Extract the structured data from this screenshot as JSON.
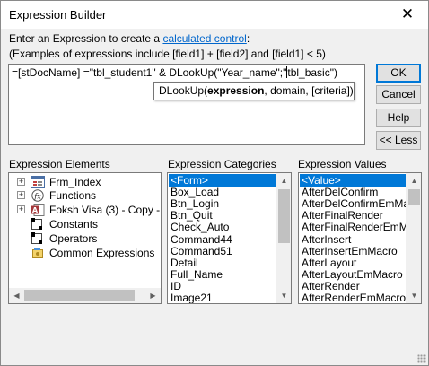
{
  "window": {
    "title": "Expression Builder",
    "close_glyph": "✕"
  },
  "instructions": {
    "line1_prefix": "Enter an Expression to create a ",
    "line1_link": "calculated control",
    "line1_suffix": ":",
    "line2": "(Examples of expressions include [field1] + [field2] and [field1] < 5)"
  },
  "expression": {
    "text_before_caret": "=[stDocName] =\"tbl_student1\" & DLookUp(\"Year_name\";\"",
    "text_after_caret": "tbl_basic\")",
    "tooltip": {
      "func": "DLookUp(",
      "bold_arg": "expression",
      "rest": ", domain, [criteria])"
    }
  },
  "buttons": {
    "ok": "OK",
    "cancel": "Cancel",
    "help": "Help",
    "less": "<< Less"
  },
  "columns": {
    "elements_label": "Expression Elements",
    "categories_label": "Expression Categories",
    "values_label": "Expression Values"
  },
  "elements": [
    {
      "label": "Frm_Index",
      "icon": "form-icon",
      "expandable": true
    },
    {
      "label": "Functions",
      "icon": "function-icon",
      "expandable": true
    },
    {
      "label": "Foksh Visa (3) - Copy - Cop",
      "icon": "database-icon",
      "expandable": true
    },
    {
      "label": "Constants",
      "icon": "constants-icon",
      "expandable": false
    },
    {
      "label": "Operators",
      "icon": "operators-icon",
      "expandable": false
    },
    {
      "label": "Common Expressions",
      "icon": "common-expressions-icon",
      "expandable": false
    }
  ],
  "categories": [
    "<Form>",
    "Box_Load",
    "Btn_Login",
    "Btn_Quit",
    "Check_Auto",
    "Command44",
    "Command51",
    "Detail",
    "Full_Name",
    "ID",
    "Image21"
  ],
  "categories_selected": 0,
  "values": [
    "<Value>",
    "AfterDelConfirm",
    "AfterDelConfirmEmMacro",
    "AfterFinalRender",
    "AfterFinalRenderEmMacro",
    "AfterInsert",
    "AfterInsertEmMacro",
    "AfterLayout",
    "AfterLayoutEmMacro",
    "AfterRender",
    "AfterRenderEmMacro"
  ],
  "values_selected": 0,
  "colors": {
    "selection": "#0078d7",
    "link": "#0066cc",
    "default_button_border": "#0078d7"
  }
}
